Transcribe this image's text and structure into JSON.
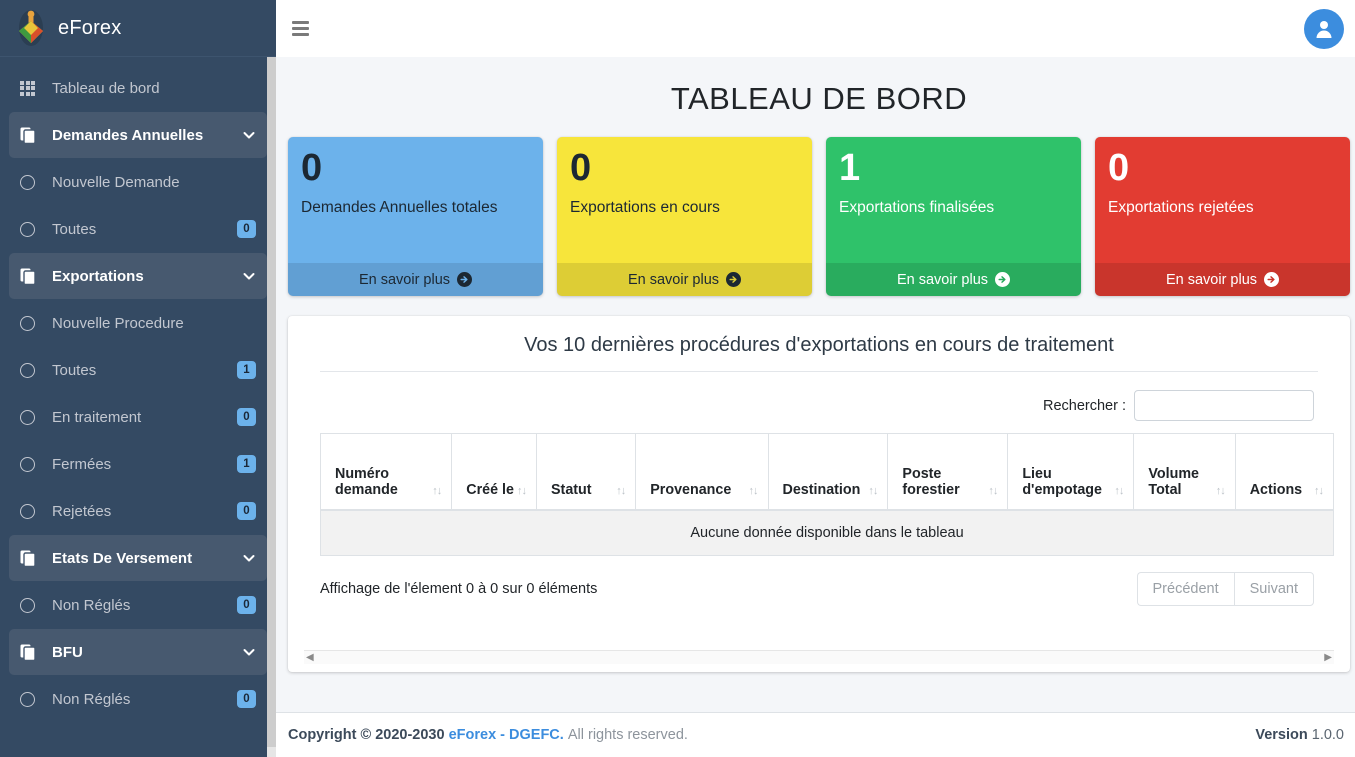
{
  "brand": {
    "name": "eForex",
    "logo_icon": "tree-logo-icon"
  },
  "sidebar": {
    "items": [
      {
        "label": "Tableau de bord",
        "icon": "grid-icon",
        "type": "link",
        "badge": null
      },
      {
        "label": "Demandes Annuelles",
        "icon": "copy-icon",
        "type": "parent",
        "badge": null
      },
      {
        "label": "Nouvelle Demande",
        "icon": "circle-icon",
        "type": "child",
        "badge": null
      },
      {
        "label": "Toutes",
        "icon": "circle-icon",
        "type": "child",
        "badge": "0"
      },
      {
        "label": "Exportations",
        "icon": "copy-icon",
        "type": "parent",
        "badge": null
      },
      {
        "label": "Nouvelle Procedure",
        "icon": "circle-icon",
        "type": "child",
        "badge": null
      },
      {
        "label": "Toutes",
        "icon": "circle-icon",
        "type": "child",
        "badge": "1"
      },
      {
        "label": "En traitement",
        "icon": "circle-icon",
        "type": "child",
        "badge": "0"
      },
      {
        "label": "Fermées",
        "icon": "circle-icon",
        "type": "child",
        "badge": "1"
      },
      {
        "label": "Rejetées",
        "icon": "circle-icon",
        "type": "child",
        "badge": "0"
      },
      {
        "label": "Etats De Versement",
        "icon": "copy-icon",
        "type": "parent",
        "badge": null
      },
      {
        "label": "Non Réglés",
        "icon": "circle-icon",
        "type": "child",
        "badge": "0"
      },
      {
        "label": "BFU",
        "icon": "copy-icon",
        "type": "parent",
        "badge": null
      },
      {
        "label": "Non Réglés",
        "icon": "circle-icon",
        "type": "child",
        "badge": "0"
      }
    ]
  },
  "topbar": {
    "menu_icon": "hamburger-icon",
    "avatar_icon": "user-avatar-icon"
  },
  "page": {
    "title": "TABLEAU DE BORD"
  },
  "cards": [
    {
      "value": "0",
      "label": "Demandes Annuelles totales",
      "link": "En savoir plus",
      "color": "#6cb2eb"
    },
    {
      "value": "0",
      "label": "Exportations en cours",
      "link": "En savoir plus",
      "color": "#f7e53b"
    },
    {
      "value": "1",
      "label": "Exportations finalisées",
      "link": "En savoir plus",
      "color": "#2fc26a"
    },
    {
      "value": "0",
      "label": "Exportations rejetées",
      "link": "En savoir plus",
      "color": "#e23c32"
    }
  ],
  "panel": {
    "title": "Vos 10 dernières procédures d'exportations en cours de traitement",
    "search_label": "Rechercher :",
    "search_value": "",
    "search_placeholder": "",
    "columns": [
      "Numéro demande",
      "Créé le",
      "Statut",
      "Provenance",
      "Destination",
      "Poste forestier",
      "Lieu d'empotage",
      "Volume Total",
      "Actions"
    ],
    "empty_message": "Aucune donnée disponible dans le tableau",
    "info": "Affichage de l'élement 0 à 0 sur 0 éléments",
    "prev_label": "Précédent",
    "next_label": "Suivant",
    "sort_icon": "sort-updown-icon"
  },
  "footer": {
    "copyright_prefix": "Copyright © 2020-2030",
    "brand_link": "eForex - DGEFC.",
    "rights": "All rights reserved.",
    "version_label": "Version",
    "version_number": "1.0.0"
  }
}
